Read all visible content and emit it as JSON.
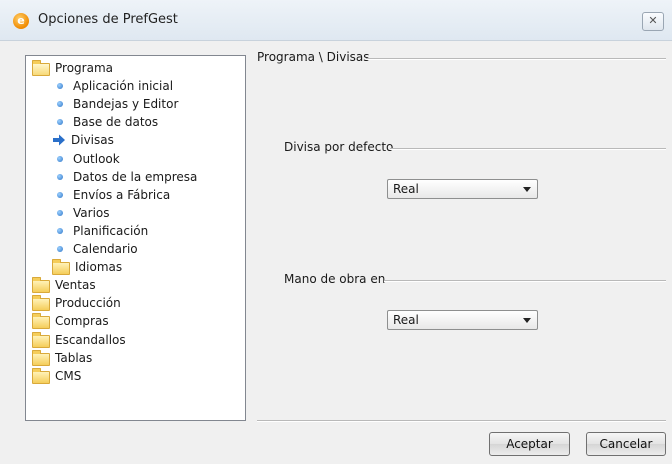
{
  "window": {
    "title": "Opciones de PrefGest",
    "close_glyph": "✕"
  },
  "tree": {
    "items": [
      {
        "label": "Programa",
        "type": "folder-open",
        "level": 0
      },
      {
        "label": "Aplicación inicial",
        "type": "bullet",
        "level": 1
      },
      {
        "label": "Bandejas y Editor",
        "type": "bullet",
        "level": 1
      },
      {
        "label": "Base de datos",
        "type": "bullet",
        "level": 1
      },
      {
        "label": "Divisas",
        "type": "arrow",
        "level": 1,
        "selected": true
      },
      {
        "label": "Outlook",
        "type": "bullet",
        "level": 1
      },
      {
        "label": "Datos de la empresa",
        "type": "bullet",
        "level": 1
      },
      {
        "label": "Envíos a Fábrica",
        "type": "bullet",
        "level": 1
      },
      {
        "label": "Varios",
        "type": "bullet",
        "level": 1
      },
      {
        "label": "Planificación",
        "type": "bullet",
        "level": 1
      },
      {
        "label": "Calendario",
        "type": "bullet",
        "level": 1
      },
      {
        "label": "Idiomas",
        "type": "folder",
        "level": 1
      },
      {
        "label": "Ventas",
        "type": "folder",
        "level": 0
      },
      {
        "label": "Producción",
        "type": "folder",
        "level": 0
      },
      {
        "label": "Compras",
        "type": "folder",
        "level": 0
      },
      {
        "label": "Escandallos",
        "type": "folder",
        "level": 0
      },
      {
        "label": "Tablas",
        "type": "folder",
        "level": 0
      },
      {
        "label": "CMS",
        "type": "folder",
        "level": 0
      }
    ]
  },
  "panel": {
    "breadcrumb": "Programa \\ Divisas",
    "divisa_label": "Divisa por defecto",
    "divisa_value": "Real",
    "mano_label": "Mano de obra en",
    "mano_value": "Real"
  },
  "buttons": {
    "ok": "Aceptar",
    "cancel": "Cancelar"
  },
  "colors": {
    "bullet": "#2f77c8",
    "arrow": "#2a6fc9",
    "folder": "#f5cd5a"
  }
}
